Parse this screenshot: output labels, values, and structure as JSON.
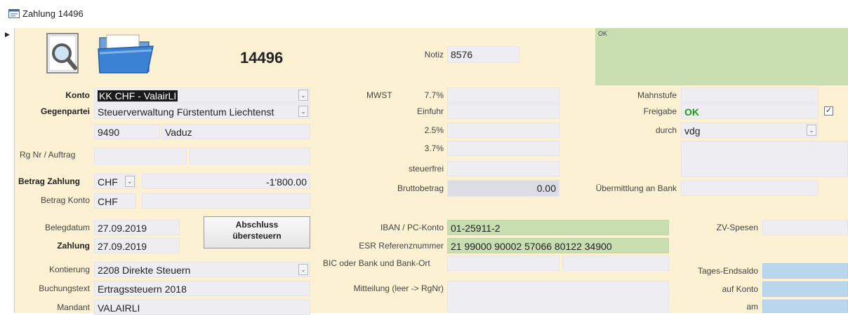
{
  "window": {
    "title": "Zahlung 14496"
  },
  "header": {
    "number": "14496",
    "notiz_label": "Notiz",
    "notiz_value": "8576",
    "ok_note": "OK"
  },
  "left": {
    "konto_label": "Konto",
    "konto_value": "KK CHF - ValairLI",
    "gegenpartei_label": "Gegenpartei",
    "gegenpartei_value": "Steuerverwaltung Fürstentum Liechtenst",
    "plz": "9490",
    "ort": "Vaduz",
    "rgnr_label": "Rg Nr / Auftrag",
    "betrag_zahlung_label": "Betrag Zahlung",
    "betrag_currency": "CHF",
    "betrag_value": "-1'800.00",
    "betrag_konto_label": "Betrag Konto",
    "betrag_konto_currency": "CHF",
    "belegdatum_label": "Belegdatum",
    "belegdatum_value": "27.09.2019",
    "zahlung_label": "Zahlung",
    "zahlung_value": "27.09.2019",
    "abschluss_line1": "Abschluss",
    "abschluss_line2": "übersteuern",
    "kontierung_label": "Kontierung",
    "kontierung_value": "2208 Direkte Steuern",
    "buchungstext_label": "Buchungstext",
    "buchungstext_value": "Ertragssteuern 2018",
    "mandant_label": "Mandant",
    "mandant_value": "VALAIRLI"
  },
  "middle": {
    "mwst_label": "MWST",
    "mwst_rate": "7.7%",
    "einfuhr_label": "Einfuhr",
    "rate_25": "2.5%",
    "rate_37": "3.7%",
    "steuerfrei_label": "steuerfrei",
    "brutto_label": "Bruttobetrag",
    "brutto_value": "0.00",
    "iban_label": "IBAN / PC-Konto",
    "iban_value": "01-25911-2",
    "esr_label": "ESR Referenznummer",
    "esr_value": "21 99000 90002 57066 80122 34900",
    "bic_label": "BIC oder Bank und Bank-Ort",
    "mitteilung_label": "Mitteilung (leer -> RgNr)"
  },
  "right": {
    "mahnstufe_label": "Mahnstufe",
    "freigabe_label": "Freigabe",
    "freigabe_value": "OK",
    "durch_label": "durch",
    "durch_value": "vdg",
    "uebermittlung_label": "Übermittlung an Bank",
    "zv_spesen_label": "ZV-Spesen",
    "tages_label": "Tages-Endsaldo",
    "auf_konto_label": "auf Konto",
    "am_label": "am"
  },
  "colors": {
    "form_bg": "#fdf1d4",
    "field_bg": "#eeeef2",
    "green_field": "#c8ddb0",
    "blue_field": "#b9d6ec",
    "freigabe_ok": "#1a9a1a"
  },
  "icons": {
    "window": "form-icon",
    "preview": "magnifier-document-icon",
    "folder": "folder-icon"
  }
}
